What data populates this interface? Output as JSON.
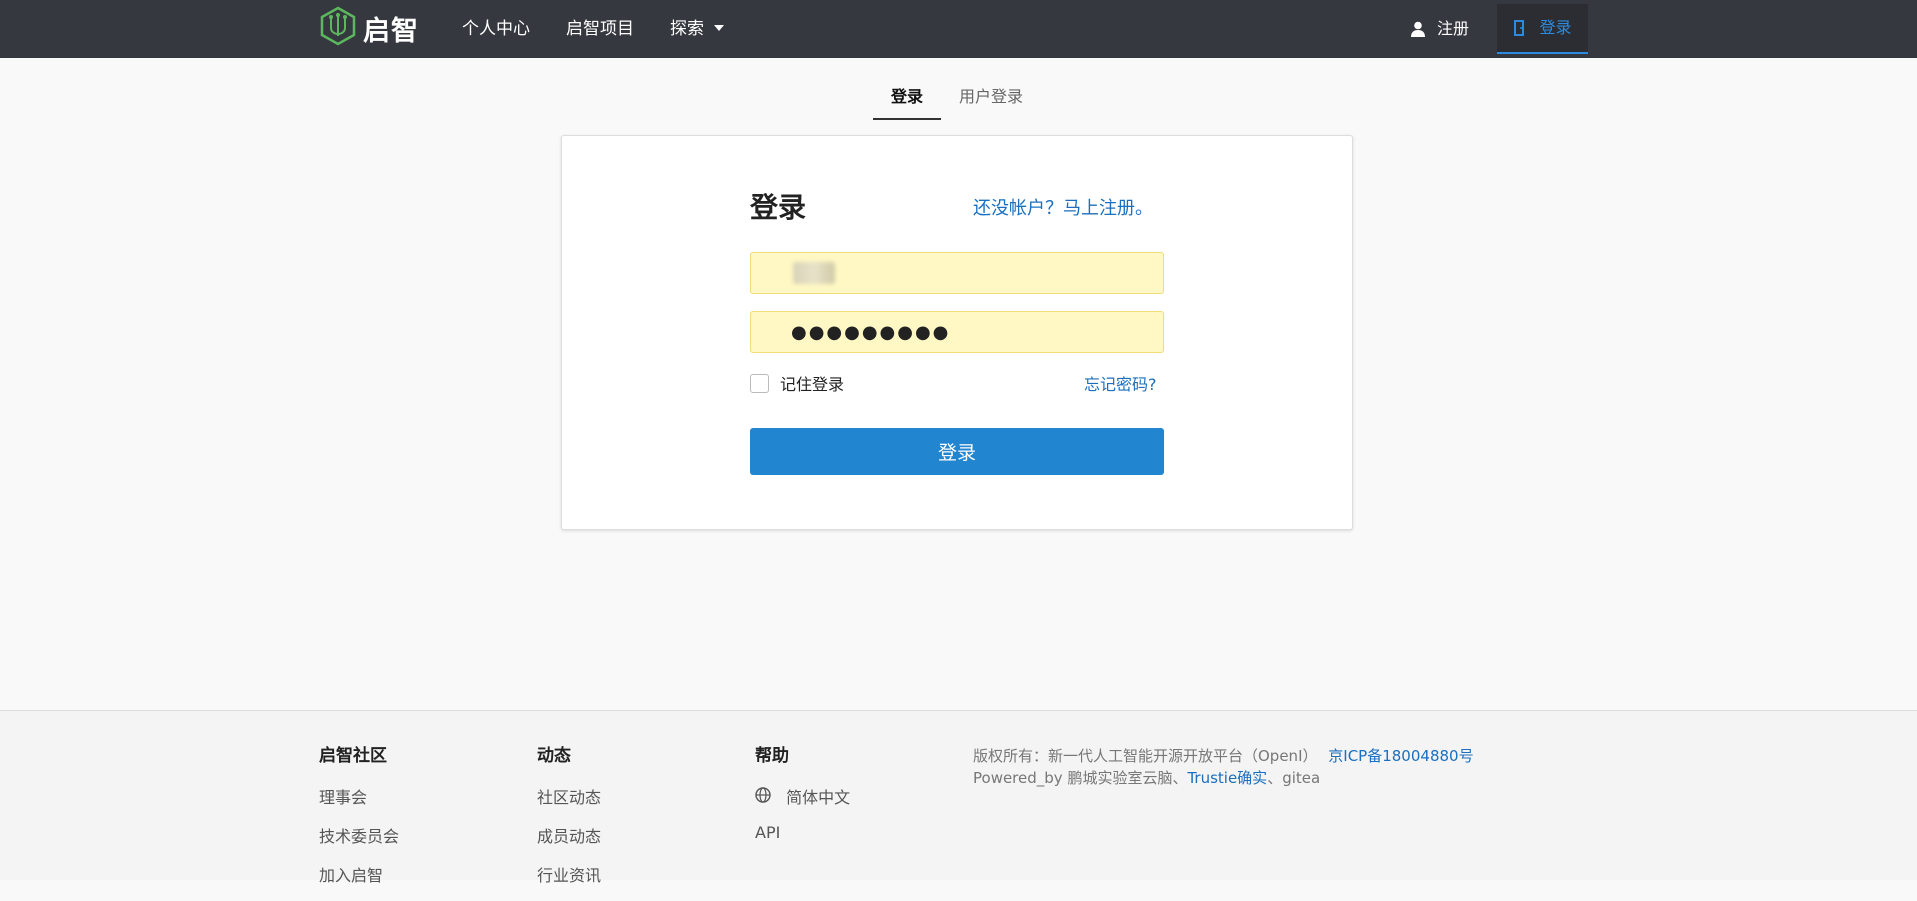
{
  "navbar": {
    "logo_text": "启智",
    "items": [
      {
        "label": "个人中心"
      },
      {
        "label": "启智项目"
      },
      {
        "label": "探索"
      }
    ],
    "register_label": "注册",
    "login_label": "登录"
  },
  "tabs": [
    {
      "label": "登录",
      "active": true
    },
    {
      "label": "用户登录",
      "active": false
    }
  ],
  "login_card": {
    "title": "登录",
    "signup_link": "还没帐户？马上注册。",
    "password_value": "●●●●●●●●●",
    "remember_label": "记住登录",
    "forgot_link": "忘记密码?",
    "submit_label": "登录"
  },
  "footer": {
    "columns": [
      {
        "heading": "启智社区",
        "links": [
          "理事会",
          "技术委员会",
          "加入启智"
        ]
      },
      {
        "heading": "动态",
        "links": [
          "社区动态",
          "成员动态",
          "行业资讯"
        ]
      },
      {
        "heading": "帮助",
        "links": [
          "简体中文",
          "API"
        ]
      }
    ],
    "copyright_prefix": "版权所有：新一代人工智能开源开放平台（OpenI）",
    "icp_link": "京ICP备18004880号",
    "powered_prefix": "Powered_by 鹏城实验室云脑、",
    "trustie_link": "Trustie确实",
    "powered_suffix": "、gitea"
  },
  "colors": {
    "navbar_bg": "#363840",
    "accent": "#2185d0",
    "link": "#1a6fbf",
    "autofill_bg": "#fff8c4"
  },
  "icons": [
    "logo-icon",
    "user-icon",
    "login-door-icon",
    "caret-down-icon",
    "globe-icon"
  ]
}
